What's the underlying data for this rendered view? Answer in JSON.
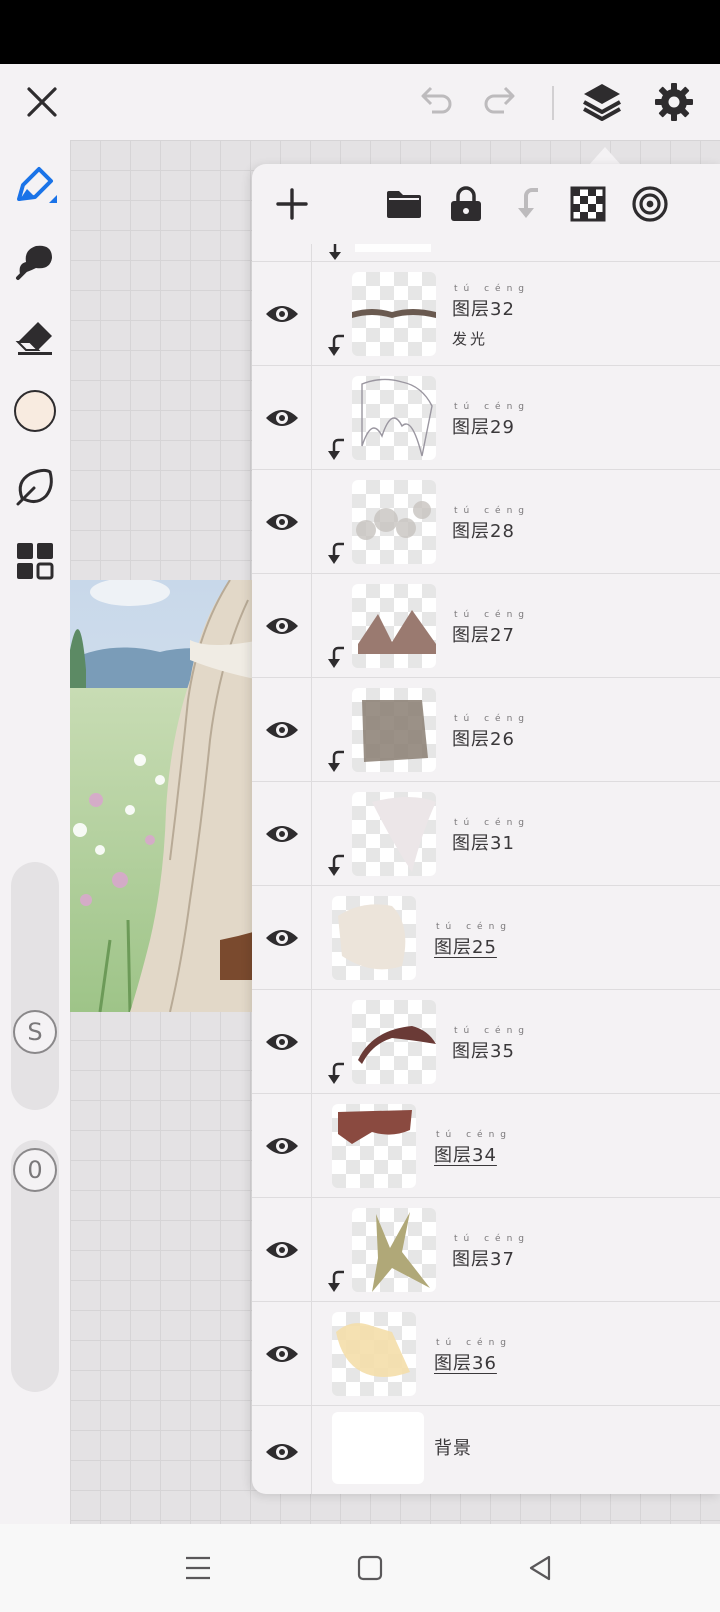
{
  "colors": {
    "accent": "#1a73e8",
    "icon_dark": "#2e2c2e",
    "icon_disabled": "#bdbbbd",
    "panel_bg": "#f4f2f4",
    "current_color": "#f8ebe0"
  },
  "top_bar": {
    "icons": [
      "close-icon",
      "undo-icon",
      "redo-icon",
      "layers-icon",
      "settings-icon"
    ]
  },
  "left_toolbar": {
    "tools": [
      "brush-icon",
      "smudge-icon",
      "eraser-icon",
      "color-swatch",
      "lasso-icon",
      "gallery-icon"
    ],
    "size_label": "S",
    "opacity_label": "0"
  },
  "layers_panel": {
    "toolbar_icons": [
      "add-icon",
      "folder-icon",
      "lock-icon",
      "merge-down-icon",
      "transparency-icon",
      "target-icon"
    ],
    "layers": [
      {
        "name": "图层32",
        "pinyin": "tú céng",
        "sub": "发光",
        "clipped": true,
        "visible": true
      },
      {
        "name": "图层29",
        "pinyin": "tú céng",
        "clipped": true,
        "visible": true
      },
      {
        "name": "图层28",
        "pinyin": "tú céng",
        "clipped": true,
        "visible": true
      },
      {
        "name": "图层27",
        "pinyin": "tú céng",
        "clipped": true,
        "visible": true
      },
      {
        "name": "图层26",
        "pinyin": "tú céng",
        "clipped": true,
        "visible": true
      },
      {
        "name": "图层31",
        "pinyin": "tú céng",
        "clipped": true,
        "visible": true
      },
      {
        "name": "图层25",
        "pinyin": "tú céng",
        "clipped": false,
        "visible": true
      },
      {
        "name": "图层35",
        "pinyin": "tú céng",
        "clipped": true,
        "visible": true
      },
      {
        "name": "图层34",
        "pinyin": "tú céng",
        "clipped": false,
        "visible": true
      },
      {
        "name": "图层37",
        "pinyin": "tú céng",
        "clipped": true,
        "visible": true
      },
      {
        "name": "图层36",
        "pinyin": "tú céng",
        "clipped": false,
        "visible": true
      },
      {
        "name": "背景",
        "clipped": false,
        "visible": true
      }
    ]
  },
  "nav_bar": {
    "icons": [
      "menu-icon",
      "home-icon",
      "back-icon"
    ]
  }
}
